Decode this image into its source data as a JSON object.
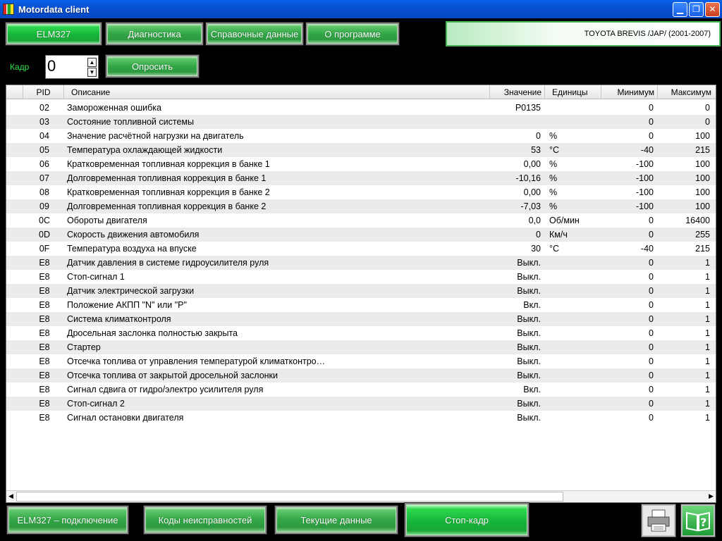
{
  "window": {
    "title": "Motordata client"
  },
  "tabs": [
    {
      "label": "ELM327"
    },
    {
      "label": "Диагностика"
    },
    {
      "label": "Справочные данные"
    },
    {
      "label": "О программе"
    }
  ],
  "vehicle": "TOYOTA  BREVIS /JAP/  (2001-2007)",
  "frame": {
    "label": "Кадр",
    "value": "0",
    "query_button": "Опросить"
  },
  "table": {
    "headers": {
      "pid": "PID",
      "desc": "Описание",
      "value": "Значение",
      "unit": "Единицы",
      "min": "Минимум",
      "max": "Максимум"
    },
    "rows": [
      {
        "pid": "02",
        "desc": "Замороженная ошибка",
        "value": "P0135",
        "unit": "",
        "min": "0",
        "max": "0"
      },
      {
        "pid": "03",
        "desc": "Состояние топливной системы",
        "value": "",
        "unit": "",
        "min": "0",
        "max": "0"
      },
      {
        "pid": "04",
        "desc": "Значение расчётной нагрузки на двигатель",
        "value": "0",
        "unit": "%",
        "min": "0",
        "max": "100"
      },
      {
        "pid": "05",
        "desc": "Температура охлаждающей жидкости",
        "value": "53",
        "unit": "°C",
        "min": "-40",
        "max": "215"
      },
      {
        "pid": "06",
        "desc": "Кратковременная топливная коррекция в банке 1",
        "value": "0,00",
        "unit": "%",
        "min": "-100",
        "max": "100"
      },
      {
        "pid": "07",
        "desc": "Долговременная топливная коррекция в банке 1",
        "value": "-10,16",
        "unit": "%",
        "min": "-100",
        "max": "100"
      },
      {
        "pid": "08",
        "desc": "Кратковременная топливная коррекция в банке 2",
        "value": "0,00",
        "unit": "%",
        "min": "-100",
        "max": "100"
      },
      {
        "pid": "09",
        "desc": "Долговременная топливная коррекция в банке 2",
        "value": "-7,03",
        "unit": "%",
        "min": "-100",
        "max": "100"
      },
      {
        "pid": "0C",
        "desc": "Обороты двигателя",
        "value": "0,0",
        "unit": "Об/мин",
        "min": "0",
        "max": "16400"
      },
      {
        "pid": "0D",
        "desc": "Скорость движения автомобиля",
        "value": "0",
        "unit": "Км/ч",
        "min": "0",
        "max": "255"
      },
      {
        "pid": "0F",
        "desc": "Температура воздуха на впуске",
        "value": "30",
        "unit": "°C",
        "min": "-40",
        "max": "215"
      },
      {
        "pid": "E8",
        "desc": "Датчик давления в системе гидроусилителя руля",
        "value": "Выкл.",
        "unit": "",
        "min": "0",
        "max": "1"
      },
      {
        "pid": "E8",
        "desc": "Стоп-сигнал 1",
        "value": "Выкл.",
        "unit": "",
        "min": "0",
        "max": "1"
      },
      {
        "pid": "E8",
        "desc": "Датчик электрической загрузки",
        "value": "Выкл.",
        "unit": "",
        "min": "0",
        "max": "1"
      },
      {
        "pid": "E8",
        "desc": "Положение АКПП \"N\" или \"P\"",
        "value": "Вкл.",
        "unit": "",
        "min": "0",
        "max": "1"
      },
      {
        "pid": "E8",
        "desc": "Система климатконтроля",
        "value": "Выкл.",
        "unit": "",
        "min": "0",
        "max": "1"
      },
      {
        "pid": "E8",
        "desc": "Дросельная заслонка полностью закрыта",
        "value": "Выкл.",
        "unit": "",
        "min": "0",
        "max": "1"
      },
      {
        "pid": "E8",
        "desc": "Стартер",
        "value": "Выкл.",
        "unit": "",
        "min": "0",
        "max": "1"
      },
      {
        "pid": "E8",
        "desc": "Отсечка топлива от управления температурой климатконтро…",
        "value": "Выкл.",
        "unit": "",
        "min": "0",
        "max": "1"
      },
      {
        "pid": "E8",
        "desc": "Отсечка топлива от закрытой дросельной заслонки",
        "value": "Выкл.",
        "unit": "",
        "min": "0",
        "max": "1"
      },
      {
        "pid": "E8",
        "desc": "Сигнал сдвига от гидро/электро усилителя руля",
        "value": "Вкл.",
        "unit": "",
        "min": "0",
        "max": "1"
      },
      {
        "pid": "E8",
        "desc": "Стоп-сигнал 2",
        "value": "Выкл.",
        "unit": "",
        "min": "0",
        "max": "1"
      },
      {
        "pid": "E8",
        "desc": "Сигнал остановки двигателя",
        "value": "Выкл.",
        "unit": "",
        "min": "0",
        "max": "1"
      }
    ]
  },
  "bottom_buttons": [
    {
      "label": "ELM327 – подключение"
    },
    {
      "label": "Коды неисправностей"
    },
    {
      "label": "Текущие данные"
    },
    {
      "label": "Стоп-кадр"
    }
  ],
  "icons": {
    "print": "printer-icon",
    "help": "help-book-icon"
  }
}
